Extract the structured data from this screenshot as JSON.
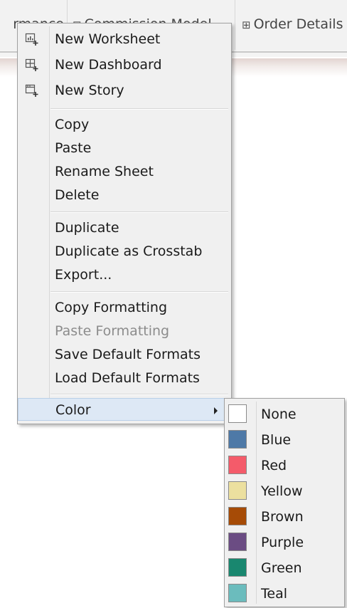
{
  "tabs": [
    {
      "label": "rmance",
      "icon": null
    },
    {
      "label": "Commission Model",
      "icon": "grid-icon"
    },
    {
      "label": "Order Details",
      "icon": "grid-icon"
    }
  ],
  "menu": {
    "items": [
      {
        "label": "New Worksheet",
        "icon": "new-worksheet-icon",
        "enabled": true
      },
      {
        "label": "New Dashboard",
        "icon": "new-dashboard-icon",
        "enabled": true
      },
      {
        "label": "New Story",
        "icon": "new-story-icon",
        "enabled": true
      },
      {
        "label": "Copy",
        "enabled": true
      },
      {
        "label": "Paste",
        "enabled": true
      },
      {
        "label": "Rename Sheet",
        "enabled": true
      },
      {
        "label": "Delete",
        "enabled": true
      },
      {
        "label": "Duplicate",
        "enabled": true
      },
      {
        "label": "Duplicate as Crosstab",
        "enabled": true
      },
      {
        "label": "Export...",
        "enabled": true
      },
      {
        "label": "Copy Formatting",
        "enabled": true
      },
      {
        "label": "Paste Formatting",
        "enabled": false
      },
      {
        "label": "Save Default Formats",
        "enabled": true
      },
      {
        "label": "Load Default Formats",
        "enabled": true
      },
      {
        "label": "Color",
        "enabled": true,
        "submenu": true,
        "highlighted": true
      }
    ]
  },
  "color_submenu": {
    "items": [
      {
        "label": "None",
        "color": "#ffffff"
      },
      {
        "label": "Blue",
        "color": "#4e79a7"
      },
      {
        "label": "Red",
        "color": "#f45b6a"
      },
      {
        "label": "Yellow",
        "color": "#ece09f"
      },
      {
        "label": "Brown",
        "color": "#a64b06"
      },
      {
        "label": "Purple",
        "color": "#6b4c83"
      },
      {
        "label": "Green",
        "color": "#19876f"
      },
      {
        "label": "Teal",
        "color": "#6bbcbd"
      }
    ]
  },
  "colors": {
    "menu_bg": "#f0f0f0",
    "highlight_bg": "#dde8f5",
    "disabled_text": "#8c8c8c"
  }
}
